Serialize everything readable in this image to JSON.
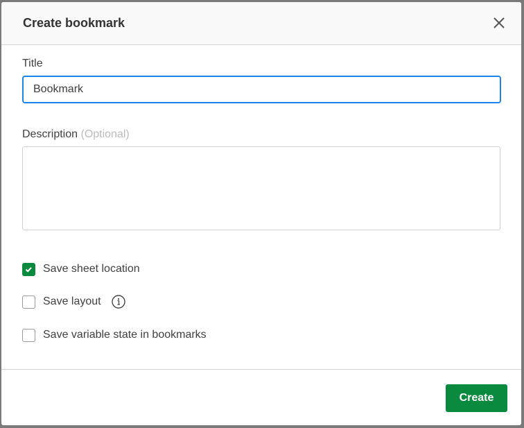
{
  "dialog": {
    "title": "Create bookmark",
    "title_label": "Title",
    "title_value": "Bookmark",
    "description_label": "Description",
    "description_optional": "(Optional)",
    "description_value": "",
    "options": [
      {
        "label": "Save sheet location",
        "checked": true
      },
      {
        "label": "Save layout",
        "checked": false
      },
      {
        "label": "Save variable state in bookmarks",
        "checked": false
      }
    ],
    "create_label": "Create"
  },
  "colors": {
    "accent": "#0a8a3e",
    "focus": "#1a85e8"
  }
}
